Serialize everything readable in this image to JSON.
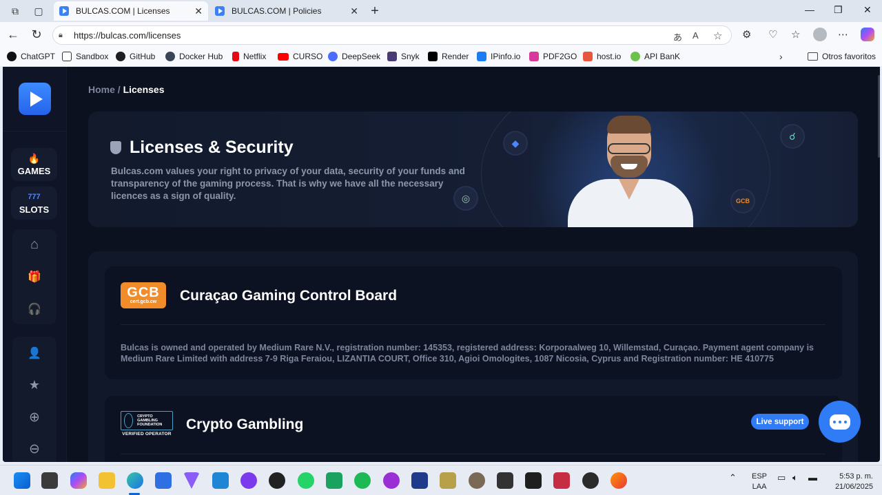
{
  "browser": {
    "tabs": [
      {
        "title": "BULCAS.COM | Licenses",
        "active": true
      },
      {
        "title": "BULCAS.COM | Policies",
        "active": false
      }
    ],
    "new_tab_icon": "+",
    "url": "https://bulcas.com/licenses",
    "bookmarks": [
      {
        "label": "ChatGPT",
        "color": "#111111"
      },
      {
        "label": "Sandbox",
        "color": "#ffffff"
      },
      {
        "label": "GitHub",
        "color": "#1b1f23"
      },
      {
        "label": "Docker Hub",
        "color": "#3a4556"
      },
      {
        "label": "Netflix",
        "color": "#e50914"
      },
      {
        "label": "CURSO",
        "color": "#ff0000"
      },
      {
        "label": "DeepSeek",
        "color": "#4d6bfe"
      },
      {
        "label": "Snyk",
        "color": "#4b3b74"
      },
      {
        "label": "Render",
        "color": "#000000"
      },
      {
        "label": "IPinfo.io",
        "color": "#1c7cf4"
      },
      {
        "label": "PDF2GO",
        "color": "#d8399a"
      },
      {
        "label": "host.io",
        "color": "#e8563b"
      },
      {
        "label": "API BanK",
        "color": "#6cc24a"
      }
    ],
    "other_favorites": "Otros favoritos"
  },
  "sidebar": {
    "categories": [
      {
        "label": "GAMES",
        "icon": "flame-icon",
        "glyph": "🔥"
      },
      {
        "label": "SLOTS",
        "icon": "slots-777-icon",
        "glyph": "777"
      }
    ],
    "group1": [
      {
        "icon": "home-icon",
        "glyph": "⌂"
      },
      {
        "icon": "gift-icon",
        "glyph": "🎁"
      },
      {
        "icon": "support-headset-icon",
        "glyph": "🎧"
      }
    ],
    "group2": [
      {
        "icon": "user-icon",
        "glyph": "👤"
      },
      {
        "icon": "star-icon",
        "glyph": "★"
      },
      {
        "icon": "plus-circle-icon",
        "glyph": "⊕"
      },
      {
        "icon": "minus-circle-icon",
        "glyph": "⊖"
      }
    ]
  },
  "breadcrumb": {
    "home": "Home",
    "separator": "/",
    "current": "Licenses"
  },
  "hero": {
    "title": "Licenses & Security",
    "description": "Bulcas.com values your right to privacy of your data, security of your funds and transparency of the gaming process. That is why we have all the necessary licences as a sign of quality."
  },
  "licenses": [
    {
      "logo_text": "GCB",
      "logo_subtext": "cert.gcb.cw",
      "title": "Curaçao Gaming Control Board",
      "text": "Bulcas is owned and operated by Medium Rare N.V., registration number: 145353, registered address: Korporaalweg 10, Willemstad, Curaçao. Payment agent company is Medium Rare Limited with address 7-9 Riga Feraiou, LIZANTIA COURT, Office 310, Agioi Omologites, 1087 Nicosia, Cyprus and Registration number: HE 410775"
    },
    {
      "logo_text": "CRYPTO GAMBLING FOUNDATION",
      "logo_subtext": "VERIFIED OPERATOR",
      "title": "Crypto Gambling"
    }
  ],
  "live_support": "Live support",
  "taskbar": {
    "language": {
      "code": "ESP",
      "layout": "LAA"
    },
    "time": "5:53 p. m.",
    "date": "21/06/2025"
  },
  "colors": {
    "accent": "#2f7cf6",
    "page_bg": "#0c1120",
    "gcb_orange": "#f08c2a"
  }
}
